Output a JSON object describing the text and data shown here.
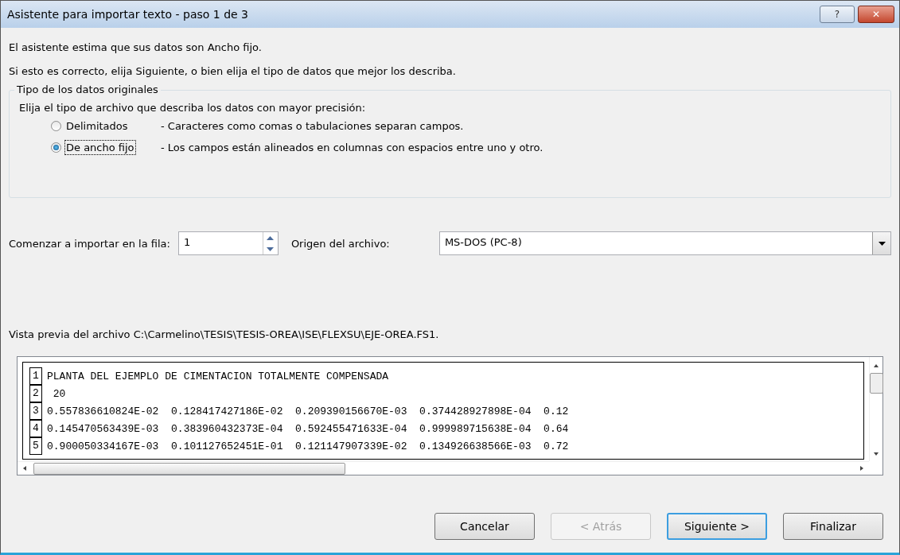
{
  "window": {
    "title": "Asistente para importar texto - paso 1 de 3",
    "help_button": "?",
    "close_button": "✕"
  },
  "intro": [
    "El asistente estima que sus datos son Ancho fijo.",
    "Si esto es correcto, elija Siguiente, o bien elija el tipo de datos que mejor los describa."
  ],
  "group": {
    "title": "Tipo de los datos originales",
    "prompt": "Elija el tipo de archivo que describa los datos con mayor precisión:",
    "options": [
      {
        "label": "Delimitados",
        "description": "- Caracteres como comas o tabulaciones separan campos.",
        "selected": false
      },
      {
        "label": "De ancho fijo",
        "description": "- Los campos están alineados en columnas con espacios entre uno y otro.",
        "selected": true
      }
    ]
  },
  "start_row": {
    "label": "Comenzar a importar en la fila:",
    "value": "1"
  },
  "origin": {
    "label": "Origen del archivo:",
    "value": "MS-DOS (PC-8)"
  },
  "preview": {
    "label": "Vista previa del archivo C:\\Carmelino\\TESIS\\TESIS-OREA\\ISE\\FLEXSU\\EJE-OREA.FS1.",
    "rows": [
      {
        "number": "1",
        "text": "PLANTA DEL EJEMPLO DE CIMENTACION TOTALMENTE COMPENSADA"
      },
      {
        "number": "2",
        "text": " 20"
      },
      {
        "number": "3",
        "text": "0.557836610824E-02  0.128417427186E-02  0.209390156670E-03  0.374428927898E-04  0.12"
      },
      {
        "number": "4",
        "text": "0.145470563439E-03  0.383960432373E-04  0.592455471633E-04  0.999989715638E-04  0.64"
      },
      {
        "number": "5",
        "text": "0.900050334167E-03  0.101127652451E-01  0.121147907339E-02  0.134926638566E-03  0.72"
      }
    ]
  },
  "buttons": [
    {
      "label": "Cancelar",
      "disabled": false,
      "default": false
    },
    {
      "label": "< Atrás",
      "disabled": true,
      "default": false
    },
    {
      "label": "Siguiente >",
      "disabled": false,
      "default": true
    },
    {
      "label": "Finalizar",
      "disabled": false,
      "default": false
    }
  ]
}
